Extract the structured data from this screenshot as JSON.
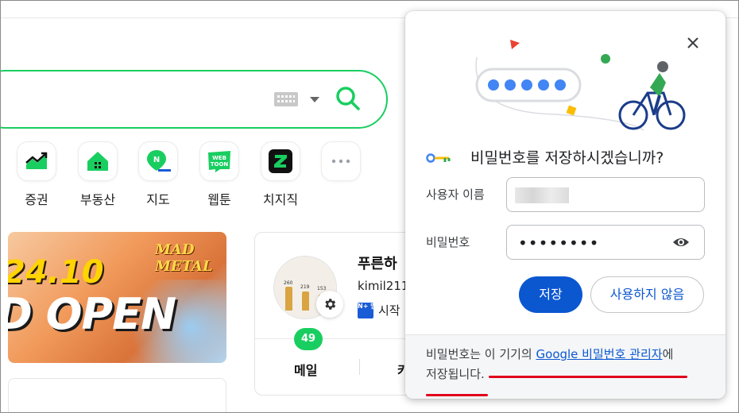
{
  "search": {
    "keyboard_icon": "keyboard-icon",
    "search_icon": "search-icon",
    "accent": "#19ce60"
  },
  "shortcuts": [
    {
      "label": "증권",
      "icon": "stock-chart-icon"
    },
    {
      "label": "부동산",
      "icon": "house-icon"
    },
    {
      "label": "지도",
      "icon": "map-icon"
    },
    {
      "label": "웹툰",
      "icon": "webtoon-icon"
    },
    {
      "label": "치지직",
      "icon": "chzzk-icon"
    },
    {
      "label": "",
      "icon": "more-icon"
    }
  ],
  "banner": {
    "date": "24.10",
    "headline": "D OPEN",
    "logo": "MAD METAL"
  },
  "user_card": {
    "name": "푸른하",
    "user_id": "kimil211",
    "start_text": "시작",
    "nplus_badge": "N+ 멤버십",
    "avatar_values": [
      "260",
      "219",
      "153"
    ],
    "mail_count": "49",
    "mail_label": "메일",
    "next_tab": "카"
  },
  "dialog": {
    "title": "비밀번호를 저장하시겠습니까?",
    "username_label": "사용자 이름",
    "password_label": "비밀번호",
    "password_value": "••••••••",
    "save_label": "저장",
    "never_label": "사용하지 않음",
    "footer_prefix": "비밀번호는 이 기기의 ",
    "footer_link": "Google 비밀번호 관리자",
    "footer_suffix": "에",
    "footer_line2": "저장됩니다.",
    "brand_color": "#0b57d0",
    "annotation_color": "#e0001a"
  }
}
